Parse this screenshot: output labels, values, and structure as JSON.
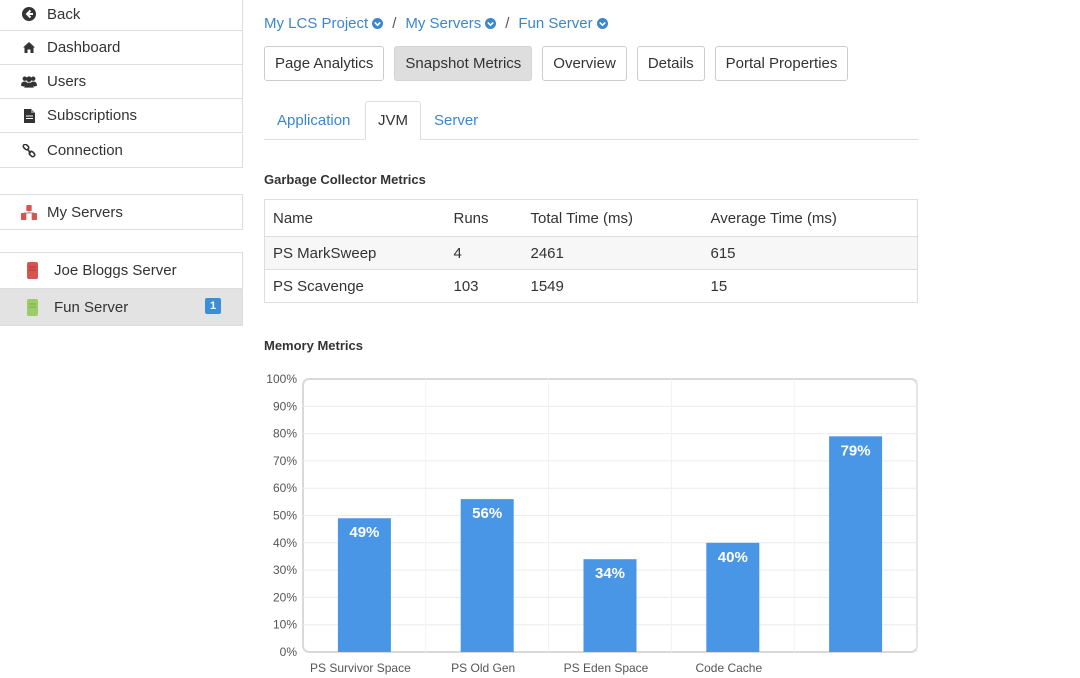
{
  "sidebar": {
    "items": [
      {
        "label": "Back",
        "icon": "arrow-left-circle-icon"
      },
      {
        "label": "Dashboard",
        "icon": "home-icon"
      },
      {
        "label": "Users",
        "icon": "users-icon"
      },
      {
        "label": "Subscriptions",
        "icon": "document-icon"
      },
      {
        "label": "Connection",
        "icon": "link-icon"
      }
    ],
    "my_servers": {
      "label": "My Servers",
      "icon": "servers-icon"
    },
    "servers": [
      {
        "label": "Joe Bloggs Server",
        "icon": "server-red-icon",
        "color": "#d9534f"
      },
      {
        "label": "Fun Server",
        "icon": "server-green-icon",
        "color": "#9ccc65",
        "badge": "1"
      }
    ]
  },
  "breadcrumb": [
    {
      "label": "My LCS Project"
    },
    {
      "label": "My Servers"
    },
    {
      "label": "Fun Server"
    }
  ],
  "buttons": [
    "Page Analytics",
    "Snapshot Metrics",
    "Overview",
    "Details",
    "Portal Properties"
  ],
  "tabs": [
    "Application",
    "JVM",
    "Server"
  ],
  "gc_section": {
    "title": "Garbage Collector Metrics",
    "columns": [
      "Name",
      "Runs",
      "Total Time (ms)",
      "Average Time (ms)"
    ],
    "rows": [
      [
        "PS MarkSweep",
        "4",
        "2461",
        "615"
      ],
      [
        "PS Scavenge",
        "103",
        "1549",
        "15"
      ]
    ]
  },
  "memory_section": {
    "title": "Memory Metrics"
  },
  "chart_data": {
    "type": "bar",
    "categories": [
      "PS Survivor Space",
      "PS Old Gen",
      "PS Eden Space",
      "Code Cache",
      ""
    ],
    "values": [
      49,
      56,
      34,
      40,
      79
    ],
    "data_labels": [
      "49%",
      "56%",
      "34%",
      "40%",
      "79%"
    ],
    "yticks": [
      "0%",
      "10%",
      "20%",
      "30%",
      "40%",
      "50%",
      "60%",
      "70%",
      "80%",
      "90%",
      "100%"
    ],
    "ylim": [
      0,
      100
    ],
    "bar_color": "#4a96e6",
    "grid": true
  },
  "colors": {
    "accent": "#3a87cf",
    "badge": "#3b8fd8"
  }
}
